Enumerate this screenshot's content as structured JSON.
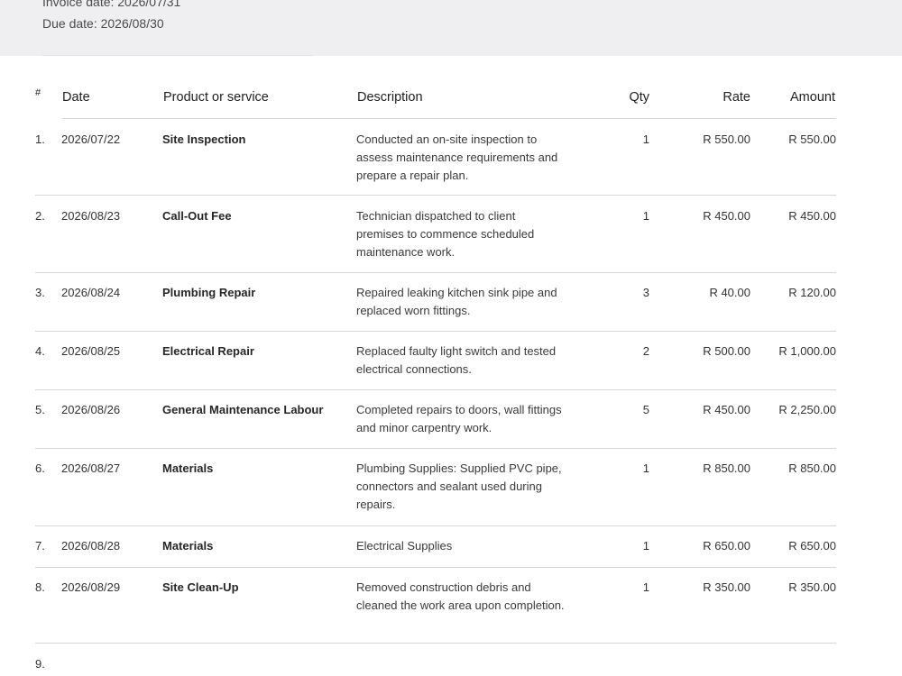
{
  "invoice": {
    "invoice_date": "Invoice date: 2026/07/31",
    "due_date": "Due date: 2026/08/30"
  },
  "table": {
    "headers": {
      "num": "#",
      "date": "Date",
      "product": "Product or service",
      "description": "Description",
      "qty": "Qty",
      "rate": "Rate",
      "amount": "Amount"
    },
    "rows": [
      {
        "num": "1.",
        "date": "2026/07/22",
        "product": "Site Inspection",
        "description": "Conducted an on-site inspection to assess maintenance requirements and prepare a repair plan.",
        "qty": "1",
        "rate": "R 550.00",
        "amount": "R 550.00"
      },
      {
        "num": "2.",
        "date": "2026/08/23",
        "product": "Call-Out Fee",
        "description": "Technician dispatched to client premises to commence scheduled maintenance work.",
        "qty": "1",
        "rate": "R 450.00",
        "amount": "R 450.00"
      },
      {
        "num": "3.",
        "date": "2026/08/24",
        "product": "Plumbing Repair",
        "description": "Repaired leaking kitchen sink pipe and replaced worn fittings.",
        "qty": "3",
        "rate": "R 40.00",
        "amount": "R 120.00"
      },
      {
        "num": "4.",
        "date": "2026/08/25",
        "product": "Electrical Repair",
        "description": "Replaced faulty light switch and tested electrical connections.",
        "qty": "2",
        "rate": "R 500.00",
        "amount": "R 1,000.00"
      },
      {
        "num": "5.",
        "date": "2026/08/26",
        "product": "General Maintenance Labour",
        "description": "Completed repairs to doors, wall fittings and minor carpentry work.",
        "qty": "5",
        "rate": "R 450.00",
        "amount": "R 2,250.00"
      },
      {
        "num": "6.",
        "date": "2026/08/27",
        "product": "Materials",
        "description": "Plumbing Supplies: Supplied PVC pipe, connectors and sealant used during repairs.",
        "qty": "1",
        "rate": "R 850.00",
        "amount": "R 850.00"
      },
      {
        "num": "7.",
        "date": "2026/08/28",
        "product": "Materials",
        "description": "Electrical Supplies",
        "qty": "1",
        "rate": "R 650.00",
        "amount": "R 650.00"
      },
      {
        "num": "8.",
        "date": "2026/08/29",
        "product": "Site Clean-Up",
        "description": "Removed construction debris and cleaned the work area upon completion.",
        "qty": "1",
        "rate": "R 350.00",
        "amount": "R 350.00"
      },
      {
        "num": "9.",
        "date": "",
        "product": "",
        "description": "",
        "qty": "",
        "rate": "",
        "amount": ""
      }
    ]
  }
}
